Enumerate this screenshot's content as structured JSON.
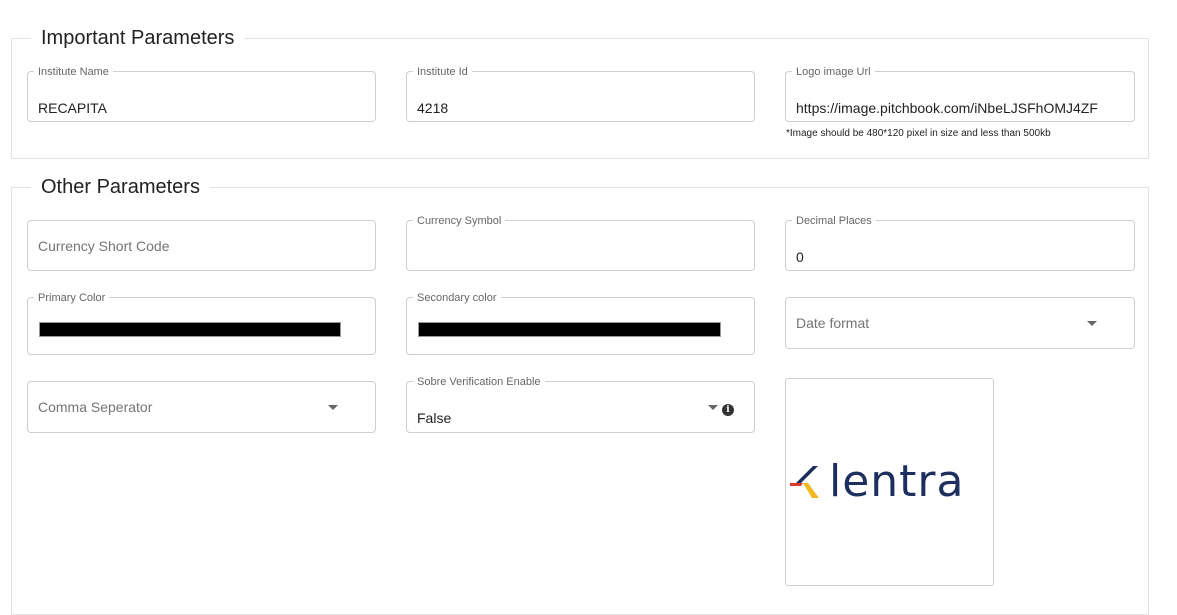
{
  "sections": {
    "important": {
      "title": "Important Parameters"
    },
    "other": {
      "title": "Other Parameters"
    }
  },
  "important": {
    "institute_name": {
      "label": "Institute Name",
      "value": "RECAPITA"
    },
    "institute_id": {
      "label": "Institute Id",
      "value": "4218"
    },
    "logo_url": {
      "label": "Logo image Url",
      "value": "https://image.pitchbook.com/iNbeLJSFhOMJ4ZF",
      "hint": "*Image should be 480*120 pixel in size and less than 500kb"
    }
  },
  "other": {
    "currency_short_code": {
      "placeholder": "Currency Short Code"
    },
    "currency_symbol": {
      "label": "Currency Symbol",
      "value": ""
    },
    "decimal_places": {
      "label": "Decimal Places",
      "value": "0"
    },
    "primary_color": {
      "label": "Primary Color",
      "value": "#000000"
    },
    "secondary_color": {
      "label": "Secondary color",
      "value": "#000000"
    },
    "date_format": {
      "placeholder": "Date format",
      "icon": "chevron-down-icon"
    },
    "comma_separator": {
      "placeholder": "Comma Seperator",
      "icon": "chevron-down-icon"
    },
    "sobre_verification": {
      "label": "Sobre Verification Enable",
      "value": "False",
      "info_icon": "i"
    }
  },
  "logo_preview": {
    "wordmark": "lentra",
    "colors": {
      "text": "#1d2f5e",
      "red": "#e03a2f",
      "yellow": "#f3b81d",
      "navy": "#1d2f5e"
    }
  }
}
